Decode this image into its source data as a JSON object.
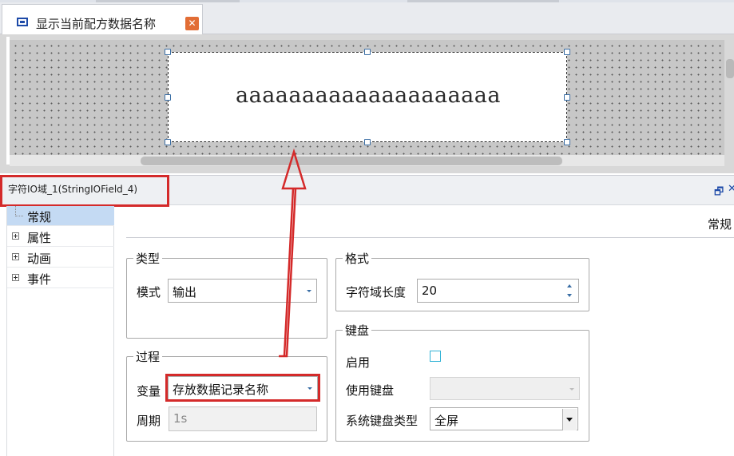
{
  "document_tab": {
    "title": "显示当前配方数据名称",
    "close_glyph": "✕",
    "icon": "screen-icon"
  },
  "canvas": {
    "io_field_text": "aaaaaaaaaaaaaaaaaaaa"
  },
  "properties": {
    "object_title": "字符IO域_1(StringIOField_4)",
    "section_label": "常规",
    "tree": [
      {
        "label": "常规",
        "selected": true
      },
      {
        "label": "属性",
        "selected": false
      },
      {
        "label": "动画",
        "selected": false
      },
      {
        "label": "事件",
        "selected": false
      }
    ],
    "type_group": {
      "title": "类型",
      "mode_label": "模式",
      "mode_value": "输出"
    },
    "process_group": {
      "title": "过程",
      "variable_label": "变量",
      "variable_value": "存放数据记录名称",
      "cycle_label": "周期",
      "cycle_value": "1s"
    },
    "format_group": {
      "title": "格式",
      "length_label": "字符域长度",
      "length_value": "20"
    },
    "keyboard_group": {
      "title": "键盘",
      "enable_label": "启用",
      "use_keyboard_label": "使用键盘",
      "use_keyboard_value": "",
      "system_keyboard_type_label": "系统键盘类型",
      "system_keyboard_type_value": "全屏"
    }
  },
  "colors": {
    "annotation_red": "#d42a2a",
    "selection_blue": "#c4daf3",
    "tab_close_orange": "#e26d35"
  }
}
